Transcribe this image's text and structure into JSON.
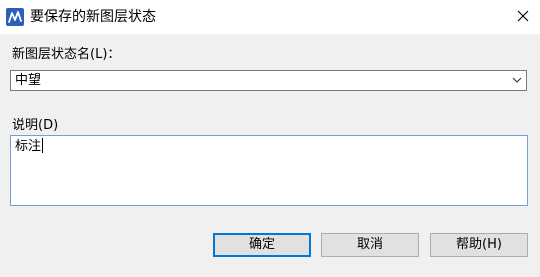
{
  "window": {
    "title": "要保存的新图层状态",
    "app_icon": "app-logo-icon",
    "close_icon": "close-icon"
  },
  "form": {
    "name_label": "新图层状态名(L)：",
    "name_value": "中望",
    "description_label": "说明(D)",
    "description_value": "标注"
  },
  "buttons": {
    "ok": "确定",
    "cancel": "取消",
    "help": "帮助(H)"
  },
  "colors": {
    "accent": "#0078d7",
    "background": "#f0f0f0"
  }
}
